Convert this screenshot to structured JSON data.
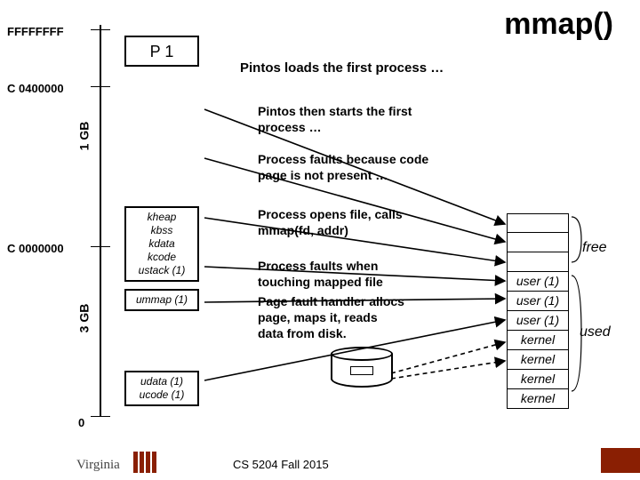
{
  "title": "mmap()",
  "subtitle": "Pintos loads the first process …",
  "addresses": {
    "ffffffff": "FFFFFFFF",
    "c0400000": "C 0400000",
    "c0000000": "C 0000000",
    "zero": "0"
  },
  "gb_labels": {
    "one": "1 GB",
    "three": "3 GB"
  },
  "p1_label": "P 1",
  "kbox1": {
    "l0": "kheap",
    "l1": "kbss",
    "l2": "kdata",
    "l3": "kcode",
    "l4": "ustack (1)"
  },
  "kbox2": {
    "l0": "ummap (1)"
  },
  "kbox3": {
    "l0": "udata (1)",
    "l1": "ucode (1)"
  },
  "bullets": {
    "b1a": "Pintos then starts the first",
    "b1b": "process …",
    "b2a": "Process faults because code",
    "b2b": "page is not present …",
    "b3a": "Process opens file, calls",
    "b3b": "mmap(fd, addr)",
    "b4a": "Process faults when",
    "b4b": "touching mapped file",
    "b5a": "Page fault handler allocs",
    "b5b": "page, maps it, reads",
    "b5c": "data from disk."
  },
  "rstack": {
    "free_blank": "",
    "user1": "user (1)",
    "kernel": "kernel"
  },
  "labels": {
    "free": "free",
    "used": "used"
  },
  "footer": "CS 5204 Fall 2015",
  "vt": "Virginia"
}
